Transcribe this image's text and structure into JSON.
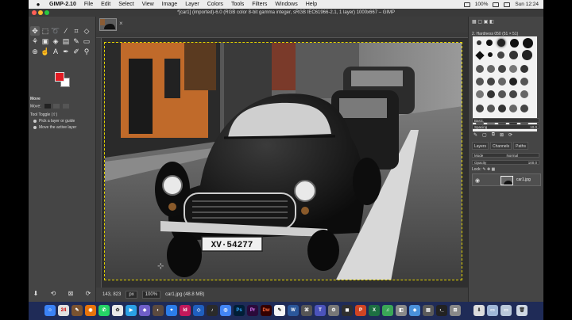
{
  "menubar": {
    "apple_icon": "apple-logo-icon",
    "app_name": "GIMP-2.10",
    "items": [
      "File",
      "Edit",
      "Select",
      "View",
      "Image",
      "Layer",
      "Colors",
      "Tools",
      "Filters",
      "Windows",
      "Help"
    ],
    "battery": "100%",
    "clock": "Sun 12:24"
  },
  "window": {
    "title": "*[car1] (imported)-6.0 (RGB color 8-bit gamma integer, sRGB IEC61966-2.1, 1 layer) 1000x667 – GIMP"
  },
  "toolbox": {
    "tool_icons": [
      "move-icon",
      "rect-select-icon",
      "lasso-icon",
      "fuzzy-select-icon",
      "crop-icon",
      "unified-transform-icon",
      "warp-icon",
      "cage-icon",
      "bucket-fill-icon",
      "gradient-icon",
      "paintbrush-icon",
      "eraser-icon",
      "clone-icon",
      "smudge-icon",
      "text-icon",
      "path-icon",
      "color-picker-icon",
      "zoom-icon"
    ],
    "fg_color": "#e31b23",
    "bg_color": "#ffffff",
    "options_title": "Move",
    "move_label": "Move:",
    "tool_toggle": "Tool Toggle  (⇧)",
    "option_1": "Pick a layer or guide",
    "option_2": "Move the active layer"
  },
  "image_tab": {
    "close_icon": "×"
  },
  "statusbar": {
    "coords": "143, 823",
    "unit": "px",
    "zoom": "100%",
    "file_info": "car1.jpg (48.8 MB)"
  },
  "dock": {
    "brush_name": "2. Hardness 050 (51 × 51)",
    "preset_label": "Basic,",
    "spacing_label": "Spacing",
    "spacing_value": "10.0",
    "tab_layers": "Layers",
    "tab_channels": "Channels",
    "tab_paths": "Paths",
    "mode_label": "Mode",
    "mode_value": "Normal",
    "opacity_label": "Opacity",
    "opacity_value": "100.0",
    "lock_label": "Lock:",
    "layer_name": "car1.jpg"
  },
  "canvas": {
    "plate": "XV·54277"
  }
}
